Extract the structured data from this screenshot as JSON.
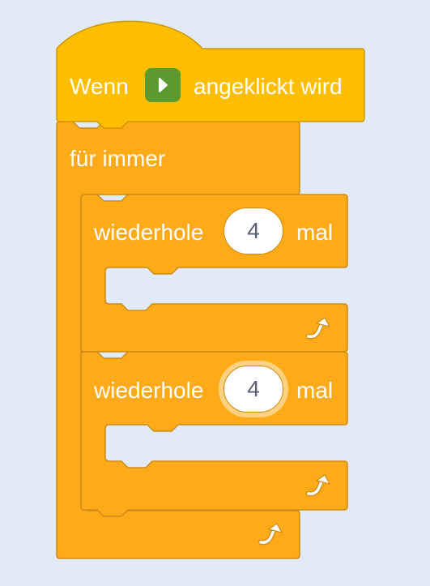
{
  "colors": {
    "background": "#e1eaf5",
    "events_block": "#ffbf00",
    "control_block": "#ffab19",
    "block_border": "#cf8b17",
    "green_flag_bg": "#5b9a2e",
    "input_text": "#575e75"
  },
  "hat_block": {
    "label_before": "Wenn",
    "flag_icon": "green-flag-icon",
    "label_after": "angeklickt wird"
  },
  "forever_block": {
    "label": "für immer",
    "loop_icon": "loop-arrow-icon"
  },
  "repeat_blocks": [
    {
      "label": "wiederhole",
      "count": "4",
      "suffix": "mal",
      "input_focused": false,
      "loop_icon": "loop-arrow-icon"
    },
    {
      "label": "wiederhole",
      "count": "4",
      "suffix": "mal",
      "input_focused": true,
      "loop_icon": "loop-arrow-icon"
    }
  ]
}
